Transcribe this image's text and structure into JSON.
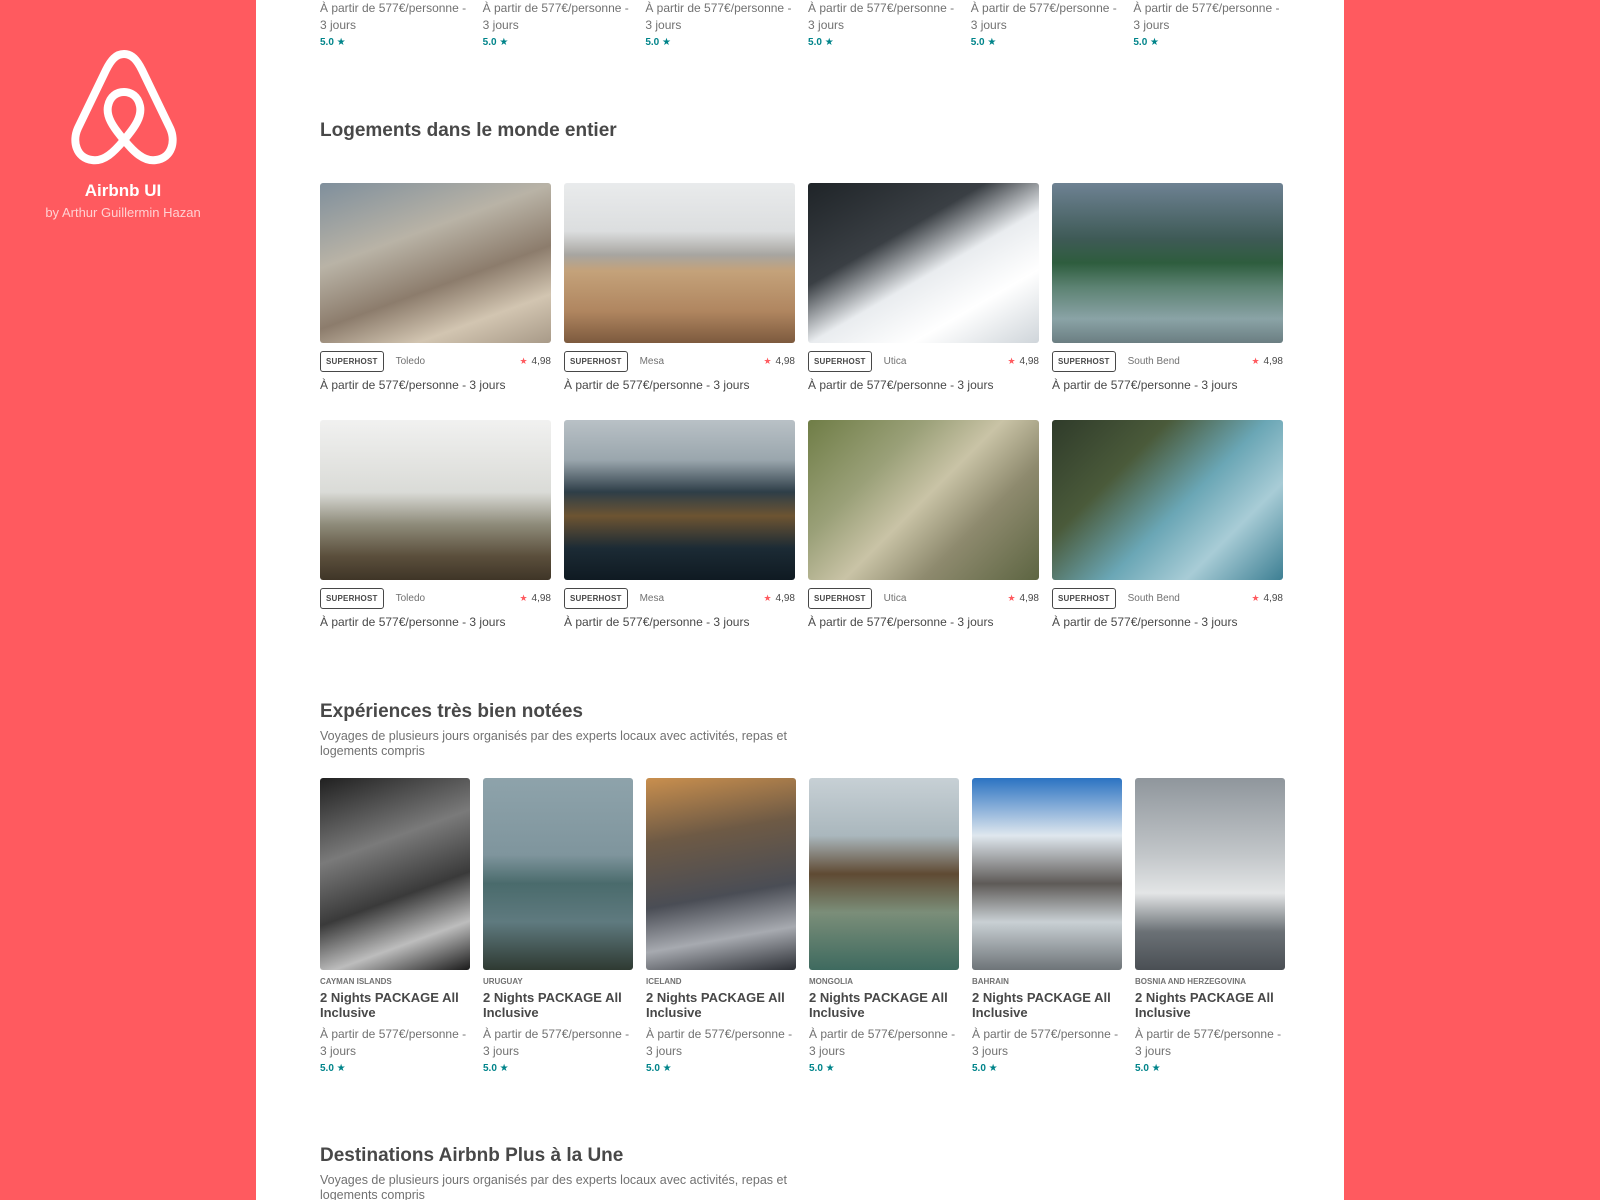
{
  "brand": {
    "title": "Airbnb UI",
    "byline": "by Arthur Guillermin Hazan",
    "color": "#ff5a5f"
  },
  "top_row": [
    {
      "price": "À partir de 577€/personne - 3 jours",
      "rating": "5.0 ★"
    },
    {
      "price": "À partir de 577€/personne - 3 jours",
      "rating": "5.0 ★"
    },
    {
      "price": "À partir de 577€/personne - 3 jours",
      "rating": "5.0 ★"
    },
    {
      "price": "À partir de 577€/personne - 3 jours",
      "rating": "5.0 ★"
    },
    {
      "price": "À partir de 577€/personne - 3 jours",
      "rating": "5.0 ★"
    },
    {
      "price": "À partir de 577€/personne - 3 jours",
      "rating": "5.0 ★"
    }
  ],
  "homes": {
    "title": "Logements dans le monde entier",
    "cards": [
      {
        "badge": "SUPERHOST",
        "city": "Toledo",
        "score": "4,98",
        "price": "À partir de 577€/personne - 3 jours"
      },
      {
        "badge": "SUPERHOST",
        "city": "Mesa",
        "score": "4,98",
        "price": "À partir de 577€/personne - 3 jours"
      },
      {
        "badge": "SUPERHOST",
        "city": "Utica",
        "score": "4,98",
        "price": "À partir de 577€/personne - 3 jours"
      },
      {
        "badge": "SUPERHOST",
        "city": "South Bend",
        "score": "4,98",
        "price": "À partir de 577€/personne - 3 jours"
      },
      {
        "badge": "SUPERHOST",
        "city": "Toledo",
        "score": "4,98",
        "price": "À partir de 577€/personne - 3 jours"
      },
      {
        "badge": "SUPERHOST",
        "city": "Mesa",
        "score": "4,98",
        "price": "À partir de 577€/personne - 3 jours"
      },
      {
        "badge": "SUPERHOST",
        "city": "Utica",
        "score": "4,98",
        "price": "À partir de 577€/personne - 3 jours"
      },
      {
        "badge": "SUPERHOST",
        "city": "South Bend",
        "score": "4,98",
        "price": "À partir de 577€/personne - 3 jours"
      }
    ]
  },
  "experiences": {
    "title": "Expériences très bien notées",
    "subtitle": "Voyages de plusieurs jours organisés par des experts locaux avec activités, repas et logements compris",
    "cards": [
      {
        "country": "CAYMAN ISLANDS",
        "name": "2 Nights PACKAGE All Inclusive",
        "price": "À partir de 577€/personne - 3 jours",
        "rating": "5.0 ★"
      },
      {
        "country": "URUGUAY",
        "name": "2 Nights PACKAGE All Inclusive",
        "price": "À partir de 577€/personne - 3 jours",
        "rating": "5.0 ★"
      },
      {
        "country": "ICELAND",
        "name": "2 Nights PACKAGE All Inclusive",
        "price": "À partir de 577€/personne - 3 jours",
        "rating": "5.0 ★"
      },
      {
        "country": "MONGOLIA",
        "name": "2 Nights PACKAGE All Inclusive",
        "price": "À partir de 577€/personne - 3 jours",
        "rating": "5.0 ★"
      },
      {
        "country": "BAHRAIN",
        "name": "2 Nights PACKAGE All Inclusive",
        "price": "À partir de 577€/personne - 3 jours",
        "rating": "5.0 ★"
      },
      {
        "country": "BOSNIA AND HERZEGOVINA",
        "name": "2 Nights PACKAGE All Inclusive",
        "price": "À partir de 577€/personne - 3 jours",
        "rating": "5.0 ★"
      }
    ]
  },
  "plus": {
    "title": "Destinations Airbnb Plus à la Une",
    "subtitle": "Voyages de plusieurs jours organisés par des experts locaux avec activités, repas et logements compris"
  }
}
